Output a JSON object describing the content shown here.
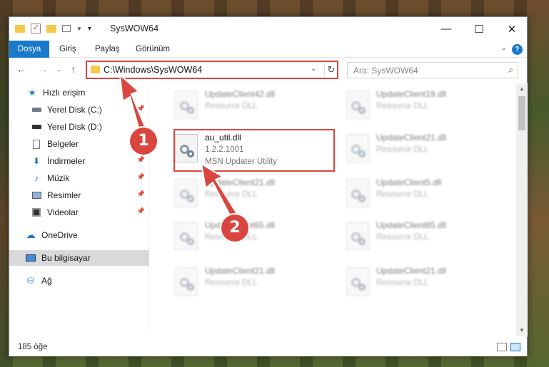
{
  "window": {
    "title": "SysWOW64",
    "controls": {
      "minimize": "—",
      "maximize": "☐",
      "close": "✕"
    }
  },
  "ribbon": {
    "tabs": [
      "Dosya",
      "Giriş",
      "Paylaş",
      "Görünüm"
    ],
    "help": "?",
    "colors": {
      "file_tab": "#1979ca"
    }
  },
  "nav": {
    "address": "C:\\Windows\\SysWOW64",
    "search_placeholder": "Ara: SysWOW64"
  },
  "sidebar": {
    "items": [
      {
        "label": "Hızlı erişim",
        "icon": "star-icon",
        "pinned": false
      },
      {
        "label": "Yerel Disk (C:)",
        "icon": "drive-icon",
        "pinned": true
      },
      {
        "label": "Yerel Disk (D:)",
        "icon": "drive-icon",
        "pinned": true
      },
      {
        "label": "Belgeler",
        "icon": "document-icon",
        "pinned": true
      },
      {
        "label": "İndirmeler",
        "icon": "download-icon",
        "pinned": true
      },
      {
        "label": "Müzik",
        "icon": "music-icon",
        "pinned": true
      },
      {
        "label": "Resimler",
        "icon": "picture-icon",
        "pinned": true
      },
      {
        "label": "Videolar",
        "icon": "video-icon",
        "pinned": true
      },
      {
        "label": "OneDrive",
        "icon": "cloud-icon",
        "pinned": false
      },
      {
        "label": "Bu bilgisayar",
        "icon": "computer-icon",
        "pinned": false,
        "selected": true
      },
      {
        "label": "Ağ",
        "icon": "network-icon",
        "pinned": false
      }
    ]
  },
  "files": {
    "highlighted": {
      "name": "au_util.dll",
      "version": "1.2.2.1001",
      "description": "MSN Updater Utility"
    },
    "blurred": [
      {
        "name": "UpdateClient42.dll",
        "desc": "Resource DLL"
      },
      {
        "name": "UpdateClient19.dll",
        "desc": "Resource DLL"
      },
      {
        "name": "UpdateClient21.dll",
        "desc": "Resource DLL"
      },
      {
        "name": "UpdateClient21.dll",
        "desc": "Resource DLL"
      },
      {
        "name": "UpdateClient5.dll",
        "desc": "Resource DLL"
      },
      {
        "name": "UpdateClient65.dll",
        "desc": "Resource DLL"
      },
      {
        "name": "UpdateClient65.dll",
        "desc": "Resource DLL"
      },
      {
        "name": "UpdateClient21.dll",
        "desc": "Resource DLL"
      },
      {
        "name": "UpdateClient21.dll",
        "desc": "Resource DLL"
      }
    ]
  },
  "status": {
    "item_count": "185 öğe"
  },
  "callouts": [
    "1",
    "2"
  ],
  "colors": {
    "highlight": "#d9463f",
    "accent": "#1979ca"
  }
}
